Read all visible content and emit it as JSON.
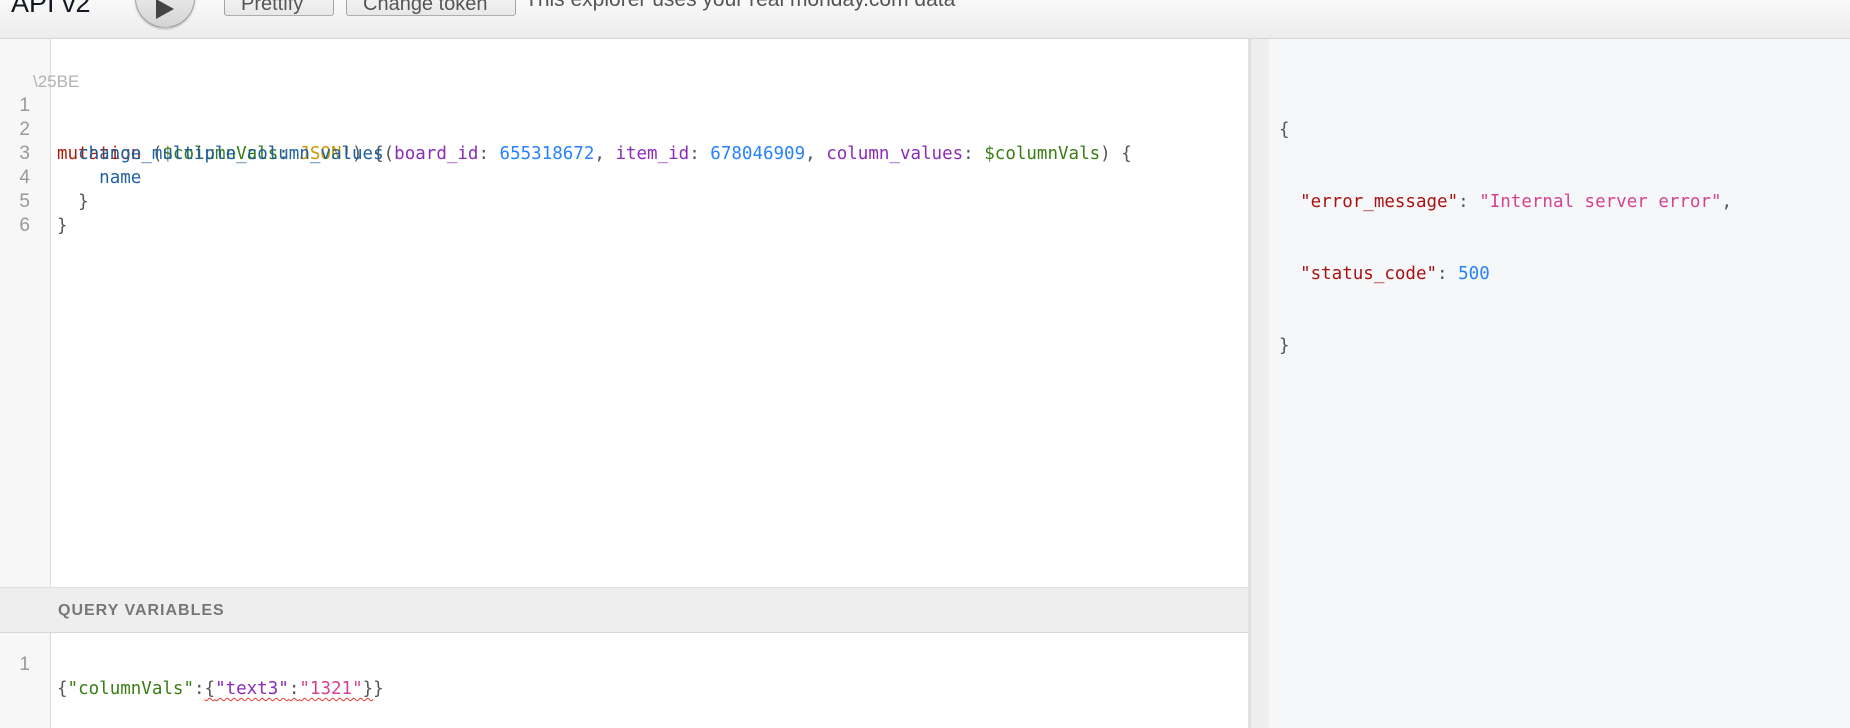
{
  "toolbar": {
    "title": "API v2",
    "run_icon": "play-icon",
    "prettify_label": "Prettify",
    "token_label": "Change token",
    "notice": "This explorer uses your real monday.com data"
  },
  "editor": {
    "line_numbers": [
      "1",
      "2",
      "3",
      "4",
      "5",
      "6"
    ],
    "fold_artifact": "\\25BE",
    "line1": {
      "keyword": "mutation",
      "open_paren": " (",
      "variable": "$columnVals",
      "colon": ": ",
      "type": "JSON",
      "close": "!) {"
    },
    "line2": {
      "indent": "  ",
      "field": "change_multiple_column_values",
      "open": "(",
      "arg1": "board_id",
      "sep1": ": ",
      "val1": "655318672",
      "comma1": ", ",
      "arg2": "item_id",
      "sep2": ": ",
      "val2": "678046909",
      "comma2": ", ",
      "arg3": "column_values",
      "sep3": ": ",
      "val3": "$columnVals",
      "close": ") {"
    },
    "line3": {
      "indent": "    ",
      "field": "name"
    },
    "line4": {
      "text": "  }"
    },
    "line5": {
      "text": "}"
    },
    "line6": {
      "text": ""
    }
  },
  "variables": {
    "title": "QUERY VARIABLES",
    "line_number": "1",
    "open": "{",
    "key": "\"columnVals\"",
    "colon": ":",
    "inner_open": "{",
    "inner_key": "\"text3\"",
    "inner_colon": ":",
    "inner_value": "\"1321\"",
    "inner_close": "}",
    "close": "}"
  },
  "result": {
    "open": "{",
    "error_key": "\"error_message\"",
    "error_value": "\"Internal server error\"",
    "status_key": "\"status_code\"",
    "status_value": "500",
    "close": "}"
  }
}
